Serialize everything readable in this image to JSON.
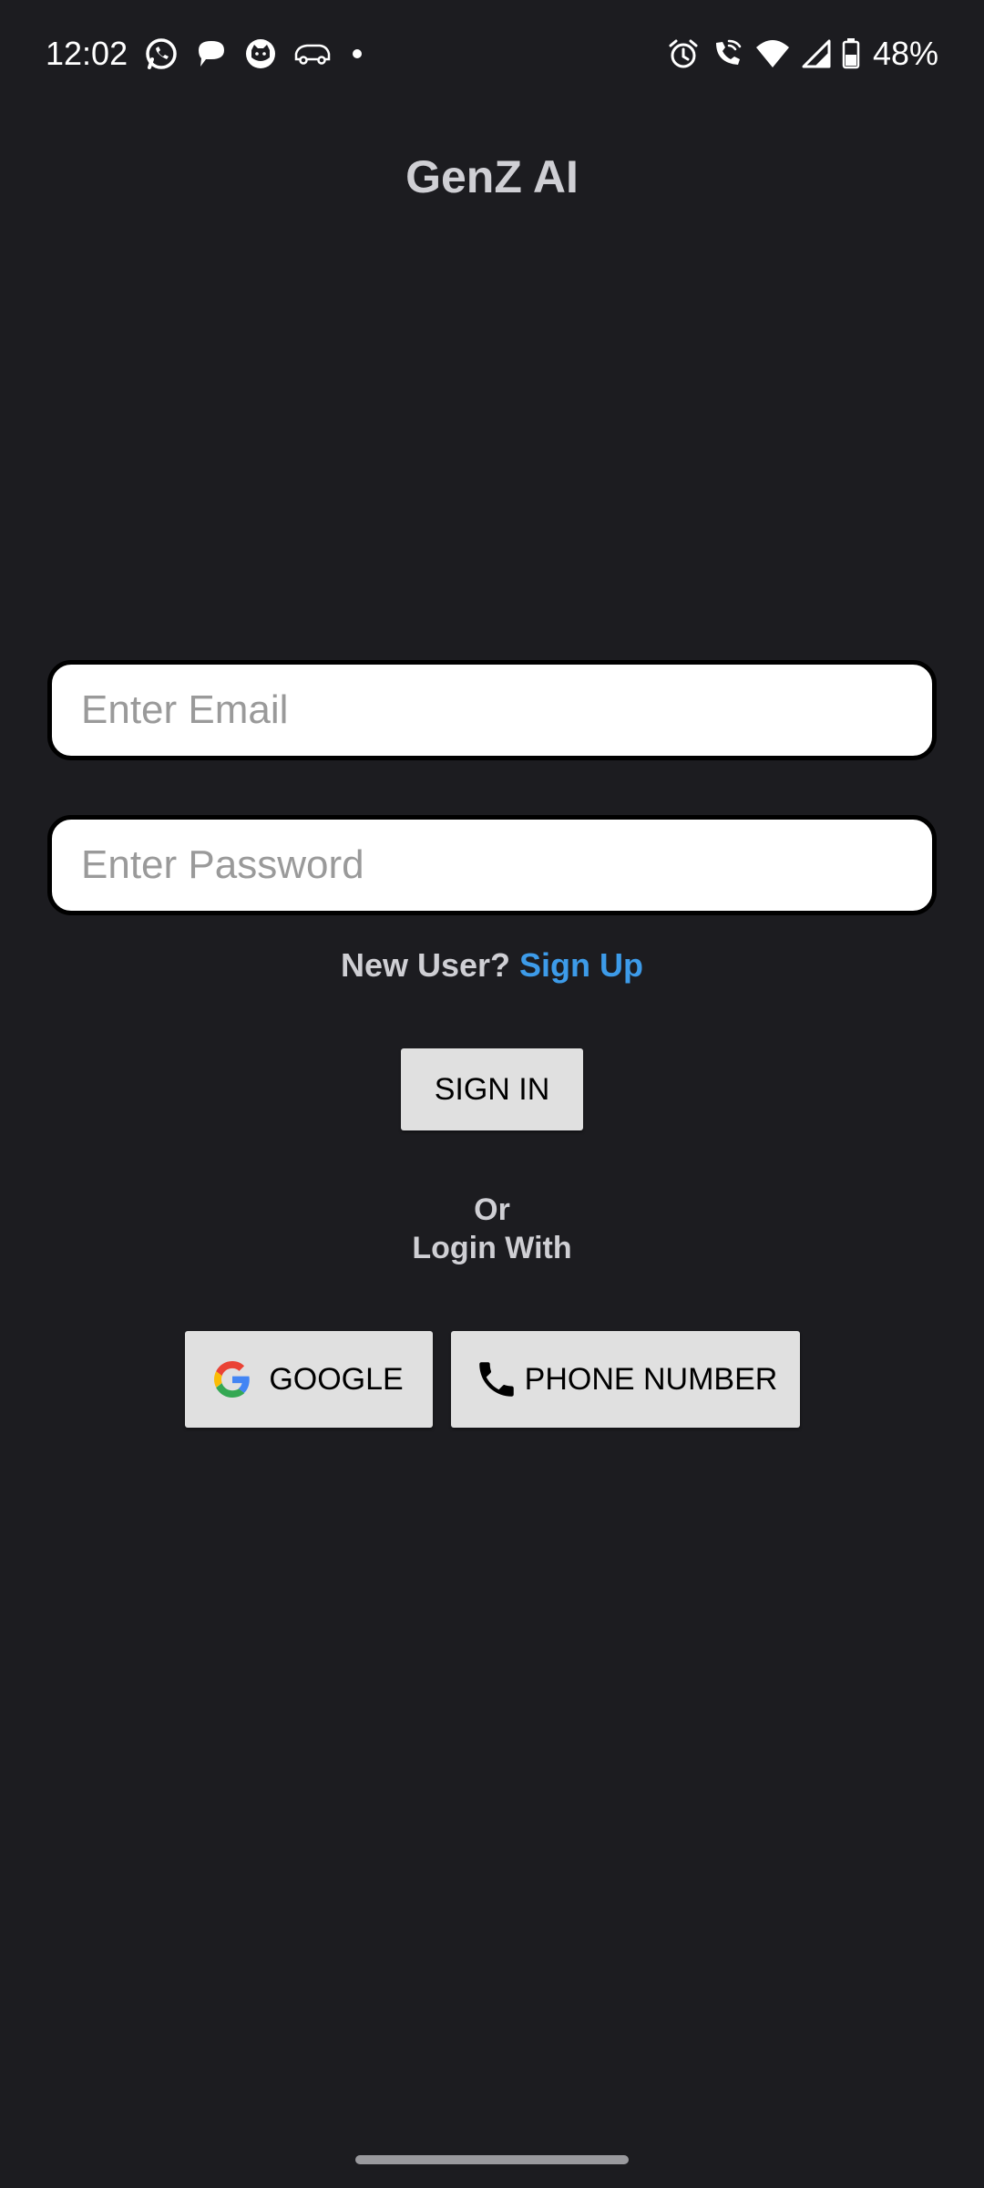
{
  "status_bar": {
    "time": "12:02",
    "battery": "48%",
    "left_icons": [
      "whatsapp-icon",
      "chat-bubble-icon",
      "cat-app-icon",
      "car-app-icon",
      "notification-dot-icon"
    ],
    "right_icons": [
      "alarm-icon",
      "wifi-call-icon",
      "wifi-icon",
      "cell-signal-icon",
      "battery-icon"
    ]
  },
  "app": {
    "title": "GenZ AI"
  },
  "login_form": {
    "email_placeholder": "Enter Email",
    "email_value": "",
    "password_placeholder": "Enter Password",
    "password_value": "",
    "new_user_label": "New User?",
    "sign_up_label": "Sign Up",
    "sign_in_label": "SIGN IN",
    "or_label": "Or",
    "login_with_label": "Login With",
    "google_label": "GOOGLE",
    "phone_label": "PHONE NUMBER"
  },
  "colors": {
    "background": "#1c1c20",
    "title_text": "#cfcfd4",
    "link": "#3d9be9",
    "button_bg": "#e0e0e0"
  }
}
